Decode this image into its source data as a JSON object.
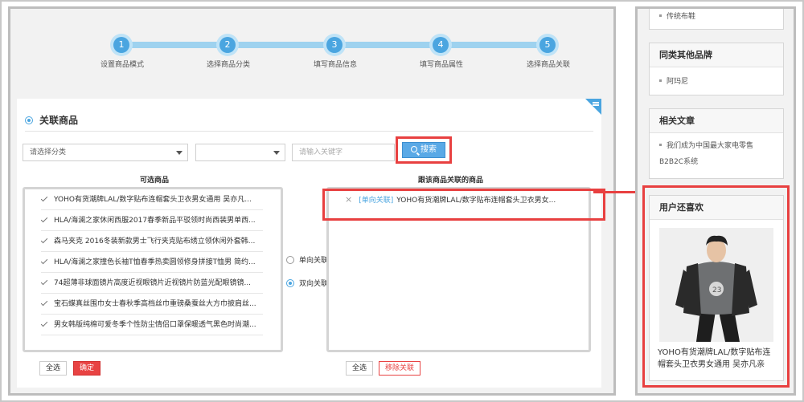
{
  "steps": [
    {
      "num": "1",
      "label": "设置商品模式"
    },
    {
      "num": "2",
      "label": "选择商品分类"
    },
    {
      "num": "3",
      "label": "填写商品信息"
    },
    {
      "num": "4",
      "label": "填写商品属性"
    },
    {
      "num": "5",
      "label": "选择商品关联"
    }
  ],
  "section": {
    "title": "关联商品"
  },
  "filters": {
    "category_placeholder": "请选择分类",
    "second_select": "",
    "keyword_placeholder": "请输入关键字",
    "search_label": "搜索"
  },
  "available": {
    "title": "可选商品",
    "items": [
      "YOHO有货潮牌LAL/数字贴布连帽套头卫衣男女通用 吴亦凡...",
      "HLA/海澜之家休闲西服2017春季新品平驳领时尚西装男单西...",
      "森马夹克 2016冬装新款男士飞行夹克贴布绣立领休闲外套韩...",
      "HLA/海澜之家撞色长袖T恤春季热卖圆领修身拼接T恤男 简约...",
      "74超薄非球面镜片高度近视眼镜片近视镜片防蓝光配眼镜镜...",
      "宝石蝶真丝围巾女士春秋季高档丝巾重磅桑蚕丝大方巾披肩丝...",
      "男女韩版纯棉可爱冬季个性防尘情侣口罩保暖透气黑色时尚潮..."
    ],
    "select_all": "全选",
    "confirm": "确定"
  },
  "relation": {
    "one_way": "单向关联",
    "two_way": "双向关联"
  },
  "linked": {
    "title": "跟该商品关联的商品",
    "items": [
      {
        "close": "×",
        "tag": "[单向关联]",
        "name": "YOHO有货潮牌LAL/数字贴布连帽套头卫衣男女..."
      }
    ],
    "select_all": "全选",
    "remove": "移除关联"
  },
  "sidebar": {
    "top_item": "传统布鞋",
    "brands_title": "同类其他品牌",
    "brands": [
      "阿玛尼"
    ],
    "articles_title": "相关文章",
    "articles": [
      "我们成为中国最大家电零售B2B2C系统"
    ],
    "fav_title": "用户还喜欢",
    "fav_product": "YOHO有货潮牌LAL/数字贴布连帽套头卫衣男女通用 吴亦凡亲"
  },
  "colors": {
    "accent": "#4aa5e0",
    "highlight": "#e84040",
    "danger": "#e84343"
  }
}
